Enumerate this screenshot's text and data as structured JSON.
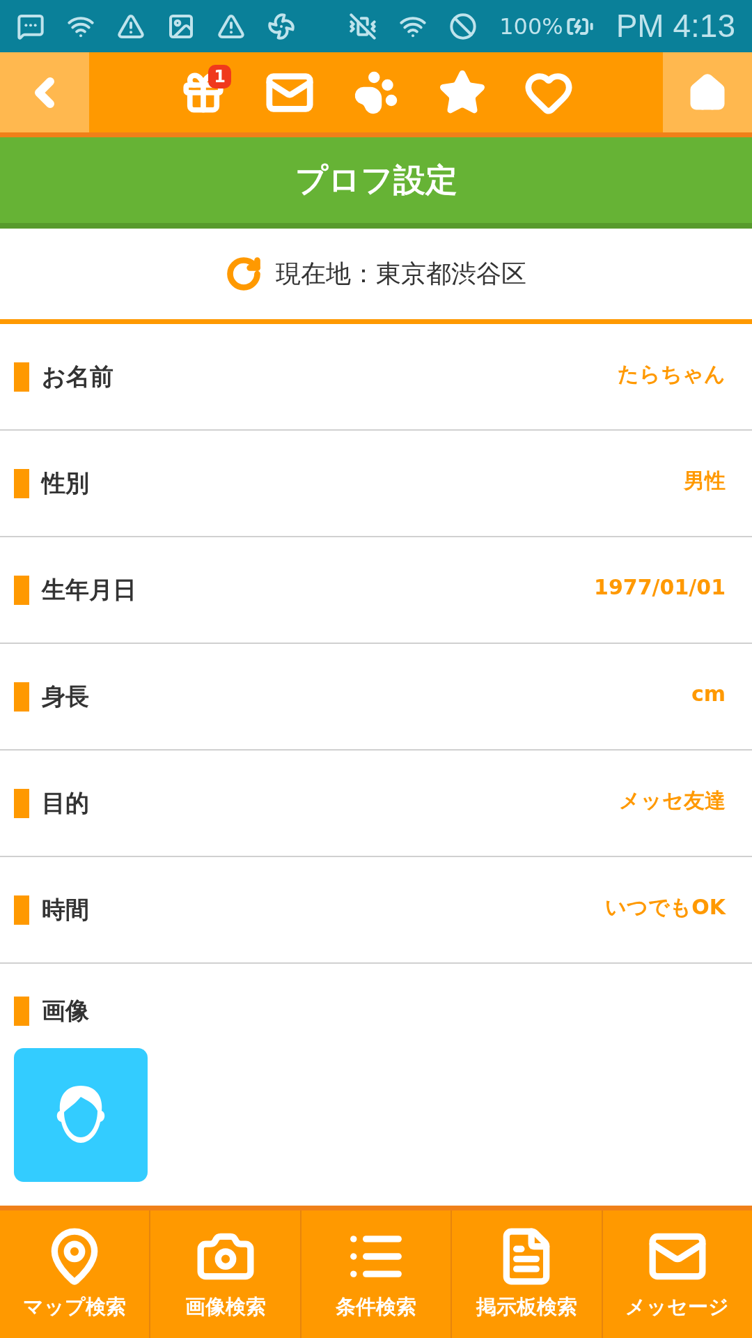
{
  "status_bar": {
    "battery": "100%",
    "time": "PM 4:13"
  },
  "header": {
    "gift_badge": "1"
  },
  "title": "プロフ設定",
  "location": "現在地：東京都渋谷区",
  "fields": [
    {
      "label": "お名前",
      "value": "たらちゃん"
    },
    {
      "label": "性別",
      "value": "男性"
    },
    {
      "label": "生年月日",
      "value": "1977/01/01"
    },
    {
      "label": "身長",
      "value": "cm"
    },
    {
      "label": "目的",
      "value": "メッセ友達"
    },
    {
      "label": "時間",
      "value": "いつでもOK"
    }
  ],
  "image_section": {
    "label": "画像"
  },
  "bottom_nav": [
    {
      "label": "マップ検索"
    },
    {
      "label": "画像検索"
    },
    {
      "label": "条件検索"
    },
    {
      "label": "掲示板検索"
    },
    {
      "label": "メッセージ"
    }
  ]
}
